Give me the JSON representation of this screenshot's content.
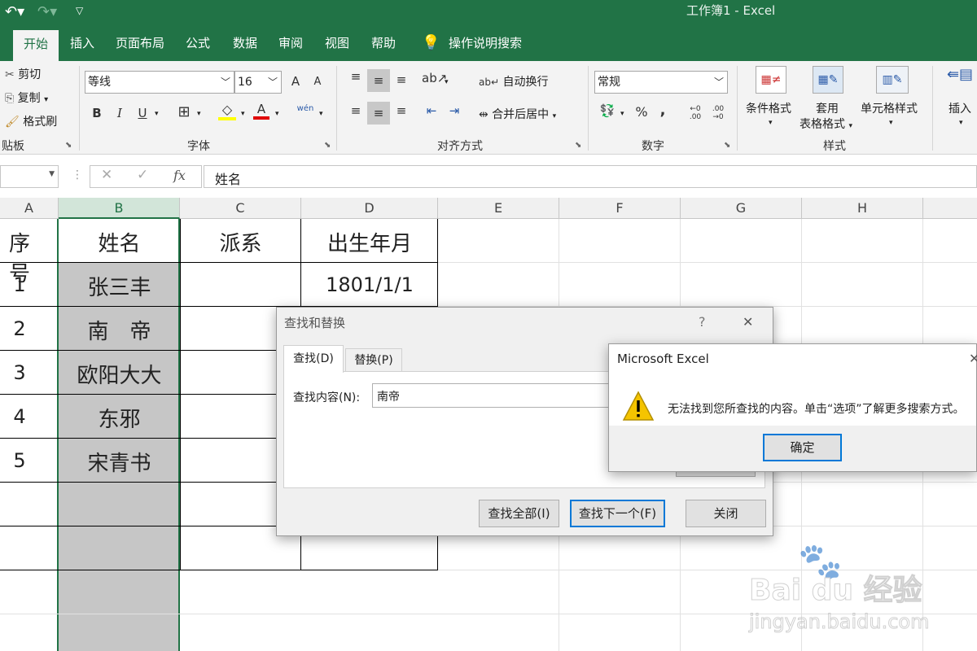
{
  "window": {
    "title": "工作簿1 - Excel"
  },
  "tabs": [
    "开始",
    "插入",
    "页面布局",
    "公式",
    "数据",
    "审阅",
    "视图",
    "帮助"
  ],
  "tell_me": "操作说明搜索",
  "ribbon": {
    "clipboard": {
      "cut": "剪切",
      "copy": "复制",
      "painter": "格式刷",
      "label": "贴板"
    },
    "font": {
      "name": "等线",
      "size": "16",
      "grow": "A",
      "shrink": "A",
      "bold": "B",
      "italic": "I",
      "underline": "U",
      "font_color": "A",
      "phonetic": "wén",
      "label": "字体"
    },
    "align": {
      "wrap": "自动换行",
      "merge": "合并后居中",
      "label": "对齐方式"
    },
    "number": {
      "format": "常规",
      "percent": "%",
      "comma": ",",
      "label": "数字"
    },
    "styles": {
      "conditional": "条件格式",
      "table_1": "套用",
      "table_2": "表格格式",
      "cell_styles": "单元格样式",
      "label": "样式"
    },
    "cells": {
      "insert": "插入"
    }
  },
  "formula_bar": {
    "fx": "fx",
    "content": "姓名"
  },
  "columns": [
    "A",
    "B",
    "C",
    "D",
    "E",
    "F",
    "G",
    "H"
  ],
  "table": {
    "headers": [
      "序号",
      "姓名",
      "派系",
      "出生年月"
    ],
    "rows": [
      [
        "1",
        "张三丰",
        "",
        "1801/1/1"
      ],
      [
        "2",
        "南　帝",
        "",
        ""
      ],
      [
        "3",
        "欧阳大大",
        "",
        ""
      ],
      [
        "4",
        "东邪",
        "",
        ""
      ],
      [
        "5",
        "宋青书",
        "",
        ""
      ]
    ]
  },
  "find_dialog": {
    "title": "查找和替换",
    "help": "?",
    "close": "✕",
    "tab_find": "查找(D)",
    "tab_replace": "替换(P)",
    "find_label": "查找内容(N):",
    "find_value": "南帝",
    "find_all": "查找全部(I)",
    "find_next": "查找下一个(F)",
    "close_btn": "关闭"
  },
  "alert": {
    "title": "Microsoft Excel",
    "message": "无法找到您所查找的内容。单击“选项”了解更多搜索方式。",
    "ok": "确定"
  },
  "watermark": {
    "brand": "Bai du 经验",
    "url": "jingyan.baidu.com"
  },
  "colors": {
    "excel_green": "#217346",
    "selection": "#c6c6c6",
    "warning": "#f5c400",
    "accent_blue": "#0078d7"
  }
}
